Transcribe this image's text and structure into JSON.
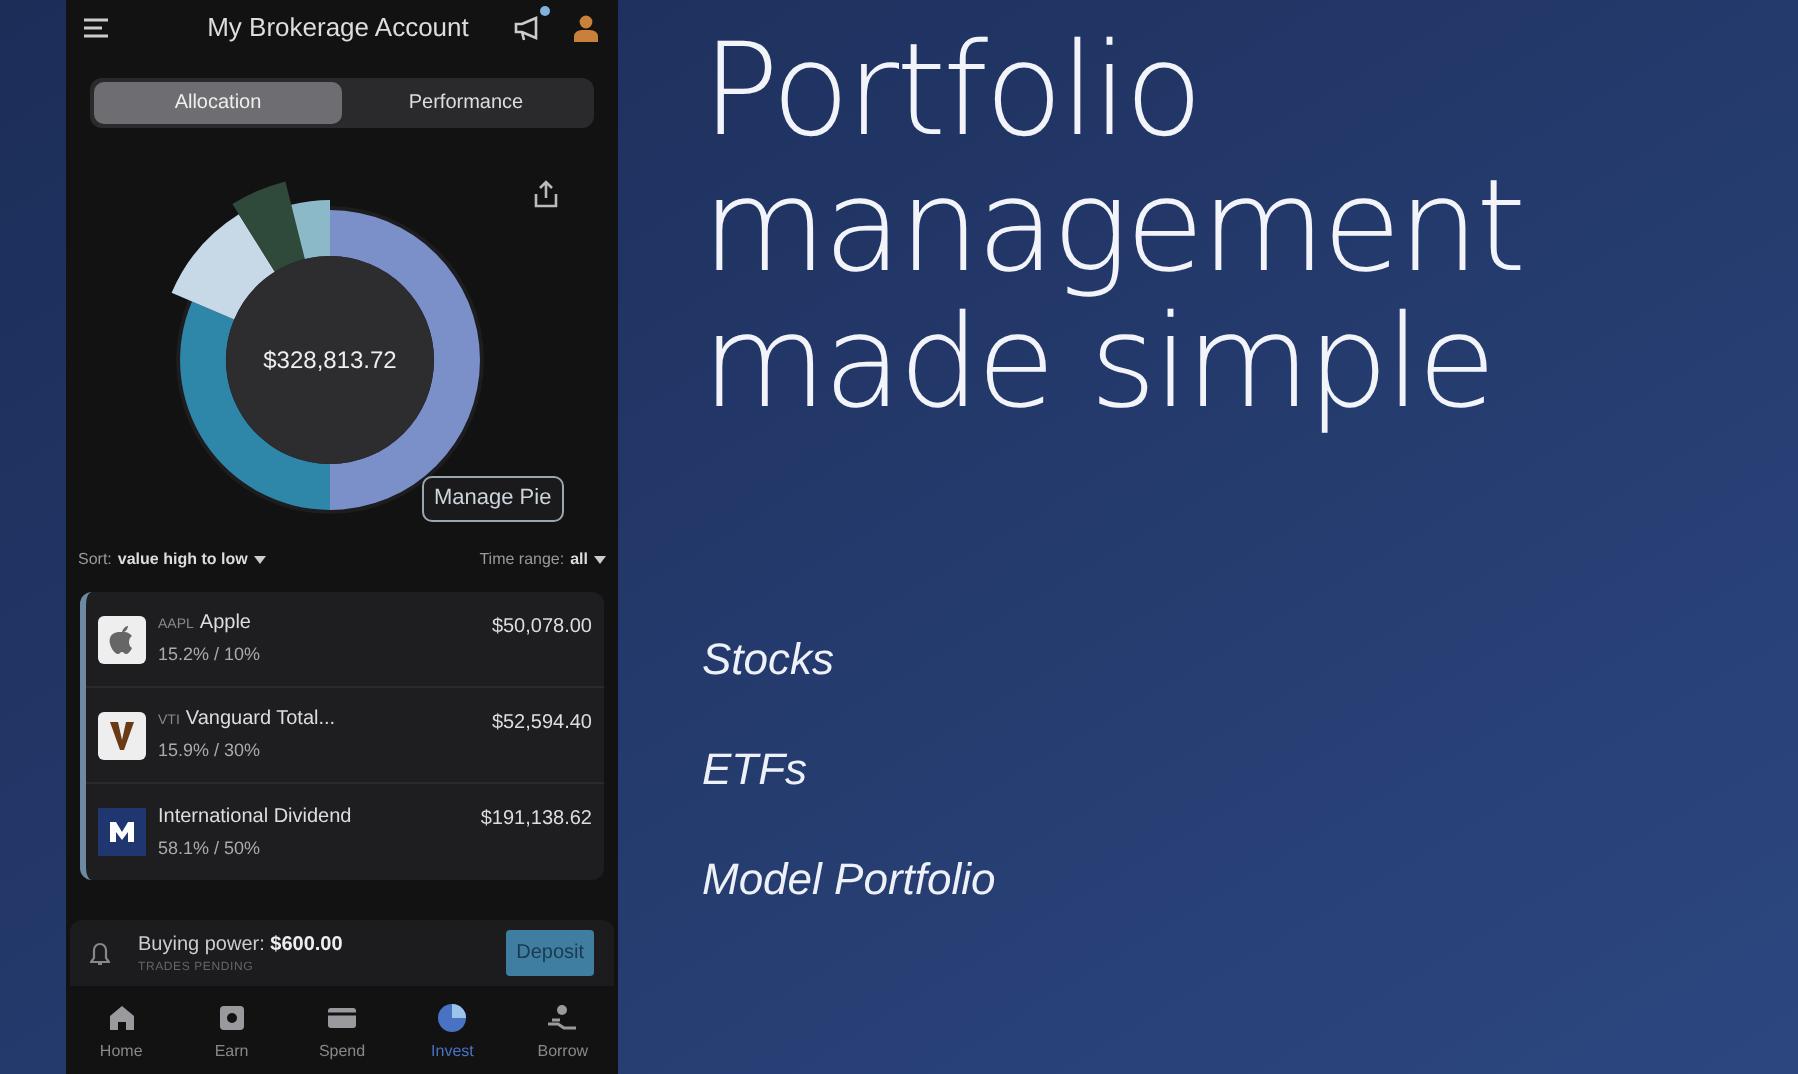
{
  "app": {
    "title": "My Brokerage Account",
    "notification_badge": true,
    "tabs": [
      {
        "label": "Allocation",
        "selected": true
      },
      {
        "label": "Performance",
        "selected": false
      }
    ],
    "total": "$328,813.72",
    "manage_button": "Manage Pie",
    "sort": {
      "label": "Sort:",
      "value": "value high to low"
    },
    "time_range": {
      "label": "Time range:",
      "value": "all"
    },
    "holdings": [
      {
        "kind": "apple",
        "ticker": "AAPL",
        "name": "Apple",
        "allocation": "15.2% / 10%",
        "value": "$50,078.00"
      },
      {
        "kind": "v",
        "ticker": "VTI",
        "name": "Vanguard Total...",
        "allocation": "15.9% / 30%",
        "value": "$52,594.40"
      },
      {
        "kind": "m",
        "name": "International Dividend",
        "allocation": "58.1% / 50%",
        "value": "$191,138.62"
      }
    ],
    "buying_power": {
      "label": "Buying power:",
      "amount": "$600.00",
      "note": "TRADES PENDING",
      "button": "Deposit"
    },
    "nav": [
      {
        "kind": "home",
        "label": "Home",
        "selected": false
      },
      {
        "kind": "earn",
        "label": "Earn",
        "selected": false
      },
      {
        "kind": "spend",
        "label": "Spend",
        "selected": false
      },
      {
        "kind": "invest",
        "label": "Invest",
        "selected": true
      },
      {
        "kind": "borrow",
        "label": "Borrow",
        "selected": false
      }
    ]
  },
  "slide": {
    "headline": [
      "Portfolio",
      "management",
      "made simple"
    ],
    "bullets": [
      "Stocks",
      "ETFs",
      "Model Portfolio"
    ]
  }
}
